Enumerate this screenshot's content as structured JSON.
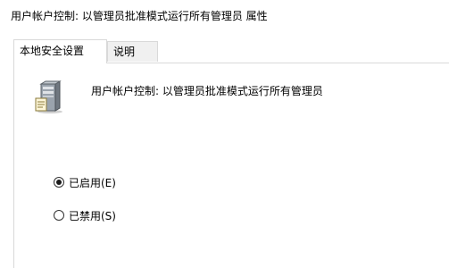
{
  "window": {
    "title": "用户帐户控制: 以管理员批准模式运行所有管理员 属性"
  },
  "tabs": [
    {
      "label": "本地安全设置",
      "active": true
    },
    {
      "label": "说明",
      "active": false
    }
  ],
  "policy": {
    "icon": "server-icon",
    "name": "用户帐户控制: 以管理员批准模式运行所有管理员"
  },
  "options": [
    {
      "label": "已启用(E)",
      "selected": true
    },
    {
      "label": "已禁用(S)",
      "selected": false
    }
  ]
}
